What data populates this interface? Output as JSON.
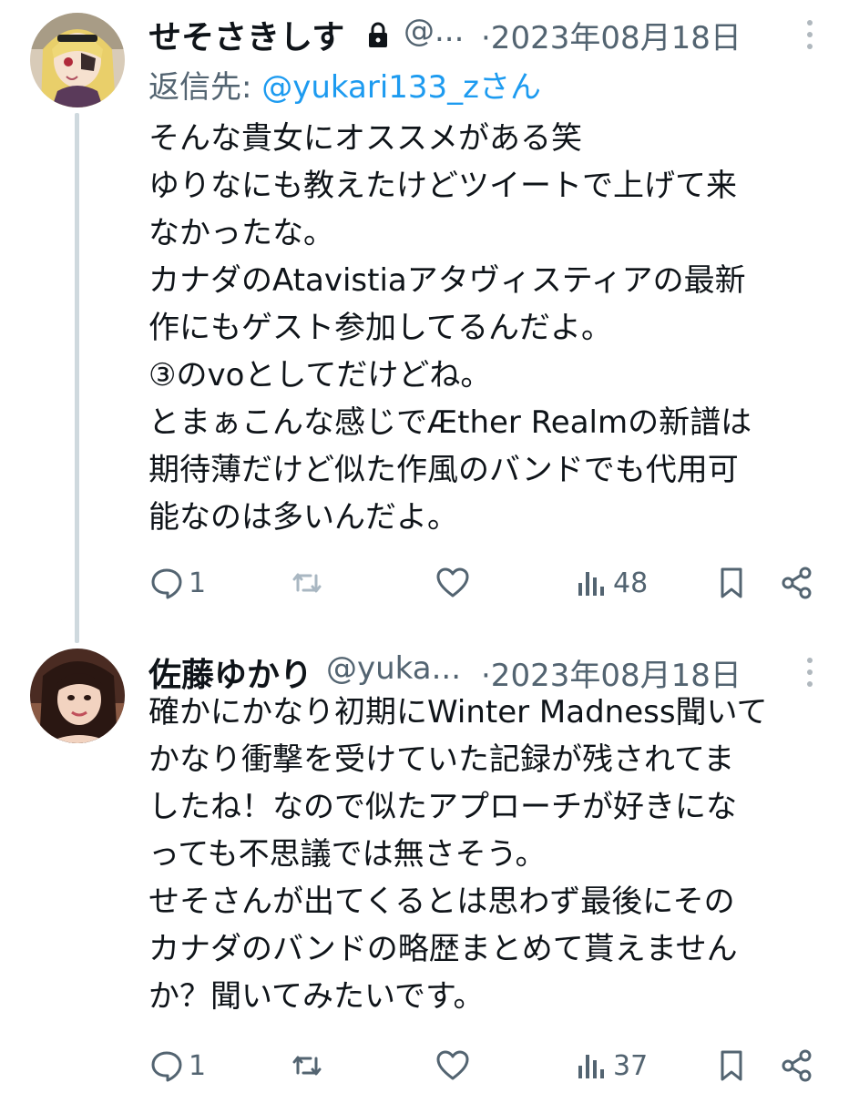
{
  "tweets": [
    {
      "display_name": "せそさきしす",
      "handle": "@...",
      "date": "·2023年08月18日",
      "reply_prefix": "返信先: ",
      "reply_mention": "@yukari133_zさん",
      "body": "そんな貴女にオススメがある笑\nゆりなにも教えたけどツイートで上げて来\nなかったな。\nカナダのAtavistiaアタヴィスティアの最新\n作にもゲスト参加してるんだよ。\n③のvoとしてだけどね。\nとまぁこんな感じでÆther Realmの新譜は\n期待薄だけど似た作風のバンドでも代用可\n能なのは多いんだよ。",
      "reply_count": "1",
      "view_count": "48",
      "icons": {
        "reply": "speech-bubble-icon",
        "retweet": "retweet-icon",
        "like": "heart-icon",
        "views": "bar-chart-icon",
        "bookmark": "bookmark-icon",
        "share": "share-icon",
        "lock": "lock-icon",
        "more": "more-vertical-icon"
      }
    },
    {
      "display_name": "佐藤ゆかり",
      "handle": "@yuka...",
      "date": "·2023年08月18日",
      "body": "確かにかなり初期にWinter Madness聞いて\nかなり衝撃を受けていた記録が残されてま\nしたね！なので似たアプローチが好きにな\nっても不思議では無さそう。\nせそさんが出てくるとは思わず最後にその\nカナダのバンドの略歴まとめて貰えません\nか？聞いてみたいです。",
      "reply_count": "1",
      "view_count": "37"
    }
  ],
  "colors": {
    "text": "#0f1419",
    "secondary": "#536471",
    "link": "#1d9bf0",
    "thread_line": "#cfd9de"
  }
}
